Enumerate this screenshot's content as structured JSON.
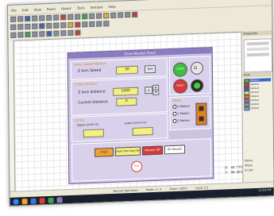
{
  "window": {
    "title": "Panel Editor"
  },
  "menubar": {
    "items": [
      "File",
      "Edit",
      "View",
      "Panel",
      "Object",
      "Tools",
      "Window",
      "Help"
    ]
  },
  "panel": {
    "title": "Drive Monitor Panel",
    "group_speed": {
      "title": "Drive Speed Monitor",
      "label": "Z Axis Speed",
      "value": "30",
      "button": "Set"
    },
    "group_position": {
      "title": "Z Axis Position",
      "label_distance": "Z Axis distance",
      "value_distance": "1000",
      "label_current": "Current distance",
      "value_current": "0"
    },
    "group_limits": {
      "title": "Limits",
      "label_upper": "Upper Limit (m)",
      "label_lower": "Lower Limit (m)"
    },
    "side": {
      "start": "START",
      "reset": "RESET"
    },
    "mode": {
      "title": "Mode",
      "options": [
        "X Motion",
        "Y Motion",
        "Z Motion"
      ]
    },
    "bottom_buttons": [
      "Stop",
      "Auto Homing ON",
      "Manual Off",
      "OK Results"
    ],
    "stop_button": "Stop"
  },
  "right_panel": {
    "header": "Properties",
    "list_header": "Item",
    "items": [
      "Default",
      "Default",
      "Default",
      "Default",
      "Default",
      "Default",
      "Default",
      "Default"
    ],
    "selected_index": 0,
    "prop_labels": [
      "Name",
      "Mode",
      "Script"
    ]
  },
  "coords": {
    "x": "X: 44.775",
    "y": "Y: 96.425"
  },
  "statusbar": {
    "items": [
      "Normal Operation",
      "Mode: 3 / 3",
      "Zoom: 100%",
      "Layer 1/1"
    ]
  },
  "taskbar": {
    "clock": "12:04 PM"
  },
  "colors": {
    "panel_bg": "#ccc3e0",
    "input_yellow": "#f3f080",
    "start_green": "#3fbf3f",
    "reset_red": "#d63a3a",
    "accent_orange": "#e08020"
  }
}
